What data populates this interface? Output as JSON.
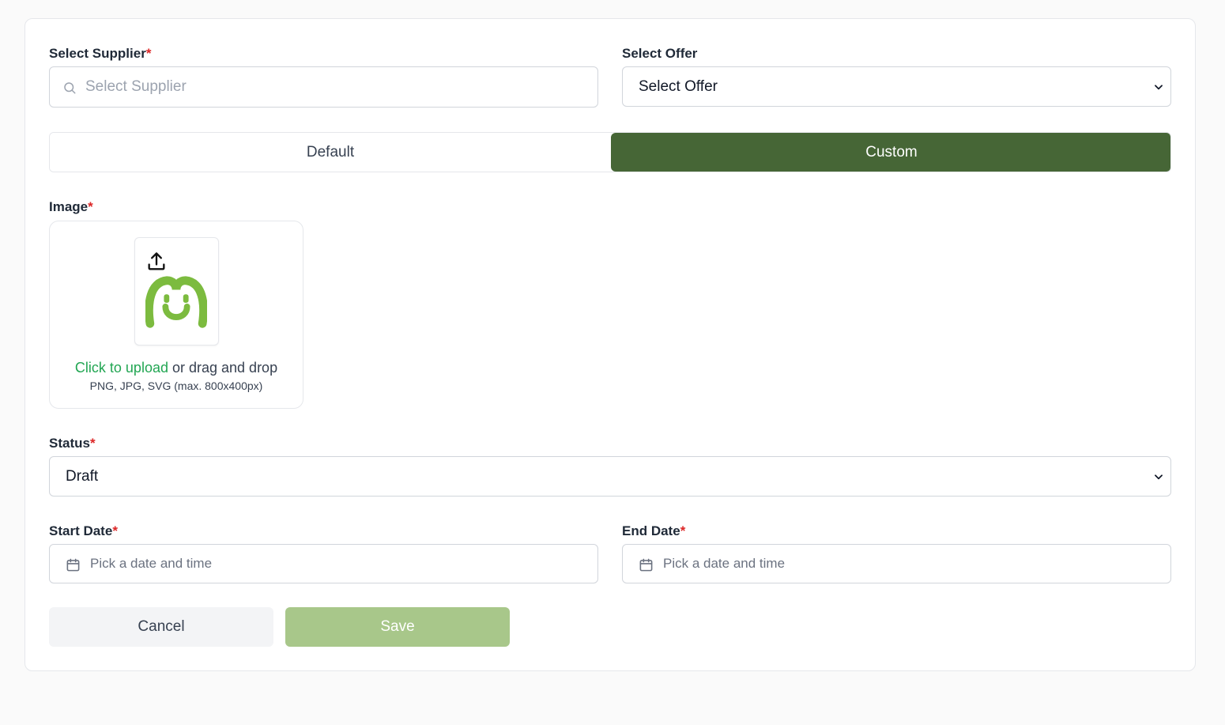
{
  "form": {
    "supplier": {
      "label": "Select Supplier",
      "required_mark": "*",
      "placeholder": "Select Supplier",
      "icon": "search-icon"
    },
    "offer": {
      "label": "Select Offer",
      "value": "Select Offer",
      "icon": "chevron-down-icon"
    },
    "mode_toggle": {
      "options": [
        "Default",
        "Custom"
      ],
      "selected": "Custom",
      "active_color": "#466636"
    },
    "image": {
      "label": "Image",
      "required_mark": "*",
      "upload_link": "Click to upload",
      "upload_rest": " or drag and drop",
      "hint": "PNG, JPG, SVG (max. 800x400px)",
      "upload_icon": "upload-icon",
      "logo_color": "#7cbb3f"
    },
    "status": {
      "label": "Status",
      "required_mark": "*",
      "value": "Draft",
      "icon": "chevron-down-icon"
    },
    "start_date": {
      "label": "Start Date",
      "required_mark": "*",
      "placeholder": "Pick a date and time",
      "icon": "calendar-icon"
    },
    "end_date": {
      "label": "End Date",
      "required_mark": "*",
      "placeholder": "Pick a date and time",
      "icon": "calendar-icon"
    },
    "actions": {
      "cancel_label": "Cancel",
      "save_label": "Save",
      "save_color": "#a8c78a"
    }
  }
}
